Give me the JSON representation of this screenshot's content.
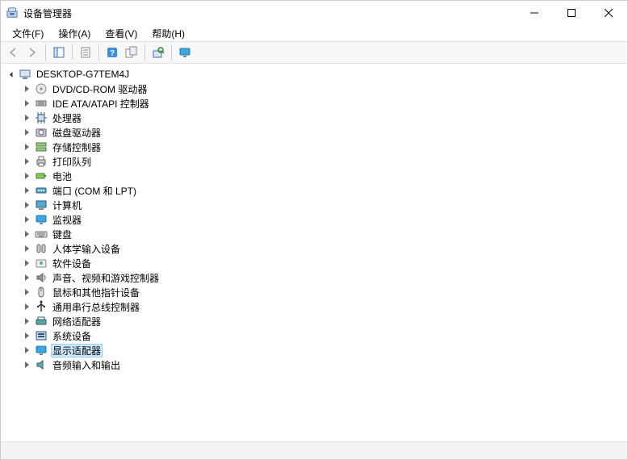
{
  "window": {
    "title": "设备管理器"
  },
  "menu": {
    "items": [
      {
        "label": "文件(F)"
      },
      {
        "label": "操作(A)"
      },
      {
        "label": "查看(V)"
      },
      {
        "label": "帮助(H)"
      }
    ]
  },
  "tree": {
    "root": {
      "label": "DESKTOP-G7TEM4J"
    },
    "children": [
      {
        "label": "DVD/CD-ROM 驱动器",
        "icon": "disc",
        "selected": false
      },
      {
        "label": "IDE ATA/ATAPI 控制器",
        "icon": "ide",
        "selected": false
      },
      {
        "label": "处理器",
        "icon": "cpu",
        "selected": false
      },
      {
        "label": "磁盘驱动器",
        "icon": "disk",
        "selected": false
      },
      {
        "label": "存储控制器",
        "icon": "storage",
        "selected": false
      },
      {
        "label": "打印队列",
        "icon": "printer",
        "selected": false
      },
      {
        "label": "电池",
        "icon": "battery",
        "selected": false
      },
      {
        "label": "端口 (COM 和 LPT)",
        "icon": "port",
        "selected": false
      },
      {
        "label": "计算机",
        "icon": "computer",
        "selected": false
      },
      {
        "label": "监视器",
        "icon": "monitor",
        "selected": false
      },
      {
        "label": "键盘",
        "icon": "keyboard",
        "selected": false
      },
      {
        "label": "人体学输入设备",
        "icon": "hid",
        "selected": false
      },
      {
        "label": "软件设备",
        "icon": "software",
        "selected": false
      },
      {
        "label": "声音、视频和游戏控制器",
        "icon": "sound",
        "selected": false
      },
      {
        "label": "鼠标和其他指针设备",
        "icon": "mouse",
        "selected": false
      },
      {
        "label": "通用串行总线控制器",
        "icon": "usb",
        "selected": false
      },
      {
        "label": "网络适配器",
        "icon": "network",
        "selected": false
      },
      {
        "label": "系统设备",
        "icon": "system",
        "selected": false
      },
      {
        "label": "显示适配器",
        "icon": "display",
        "selected": true
      },
      {
        "label": "音频输入和输出",
        "icon": "audio",
        "selected": false
      }
    ]
  }
}
